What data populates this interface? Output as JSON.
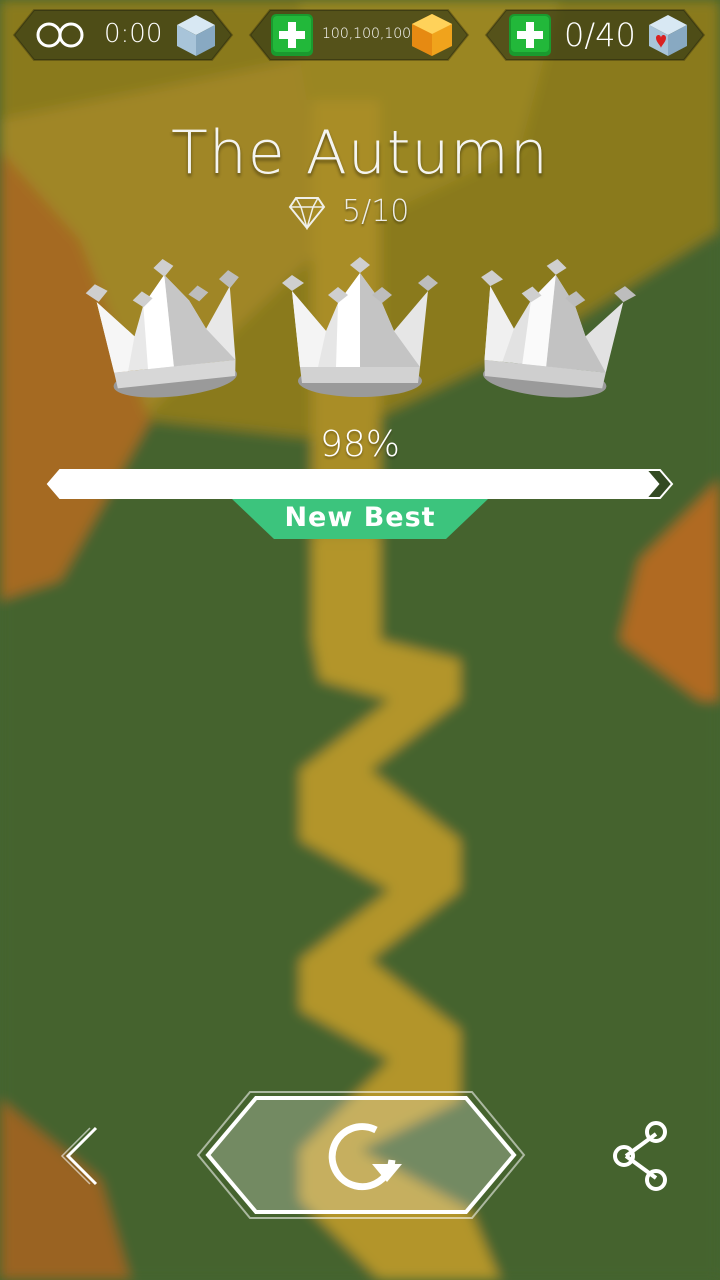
{
  "hud": {
    "time_value": "0:00",
    "gems_value": "100,100,100",
    "lives_value": "0/40"
  },
  "level": {
    "title": "The Autumn",
    "diamonds": "5/10",
    "crowns_total": 3,
    "progress_percent_label": "98%",
    "progress": 0.98,
    "badge_label": "New Best"
  },
  "controls": {
    "back_icon": "chevron-left-icon",
    "replay_icon": "replay-icon",
    "share_icon": "share-icon"
  },
  "colors": {
    "grass": "#44642f",
    "path": "#b79a2e",
    "badge": "#3cc47d",
    "plus_button": "#22b83a",
    "gem_orange": "#f5a623",
    "cube_blue": "#a9c8e0"
  }
}
